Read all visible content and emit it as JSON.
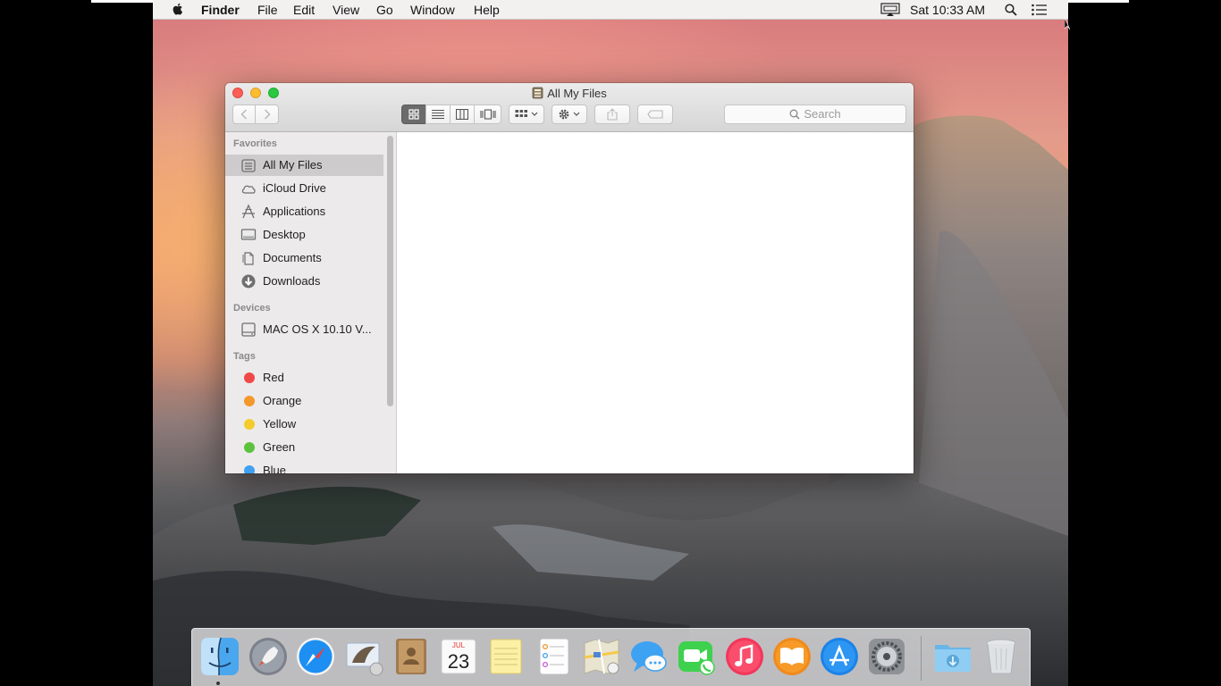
{
  "menubar": {
    "app_name": "Finder",
    "menus": [
      "File",
      "Edit",
      "View",
      "Go",
      "Window",
      "Help"
    ],
    "clock": "Sat 10:33 AM"
  },
  "window": {
    "title": "All My Files",
    "search_placeholder": "Search"
  },
  "sidebar": {
    "favorites_header": "Favorites",
    "favorites": [
      {
        "label": "All My Files",
        "icon": "all-my-files-icon",
        "selected": true
      },
      {
        "label": "iCloud Drive",
        "icon": "cloud-icon"
      },
      {
        "label": "Applications",
        "icon": "applications-icon"
      },
      {
        "label": "Desktop",
        "icon": "desktop-icon"
      },
      {
        "label": "Documents",
        "icon": "documents-icon"
      },
      {
        "label": "Downloads",
        "icon": "downloads-icon"
      }
    ],
    "devices_header": "Devices",
    "devices": [
      {
        "label": "MAC OS X 10.10 V...",
        "icon": "disk-icon"
      }
    ],
    "tags_header": "Tags",
    "tags": [
      {
        "label": "Red",
        "color": "#f04848"
      },
      {
        "label": "Orange",
        "color": "#f4982c"
      },
      {
        "label": "Yellow",
        "color": "#f3cc2b"
      },
      {
        "label": "Green",
        "color": "#5cc23e"
      },
      {
        "label": "Blue",
        "color": "#3f9ff2"
      }
    ]
  },
  "dock": {
    "apps": [
      "Finder",
      "Launchpad",
      "Safari",
      "Mail",
      "Contacts",
      "Calendar",
      "Notes",
      "Reminders",
      "Maps",
      "Messages",
      "FaceTime",
      "iTunes",
      "iBooks",
      "App Store",
      "System Preferences",
      "Downloads",
      "Trash"
    ],
    "calendar_month": "JUL",
    "calendar_day": "23"
  }
}
